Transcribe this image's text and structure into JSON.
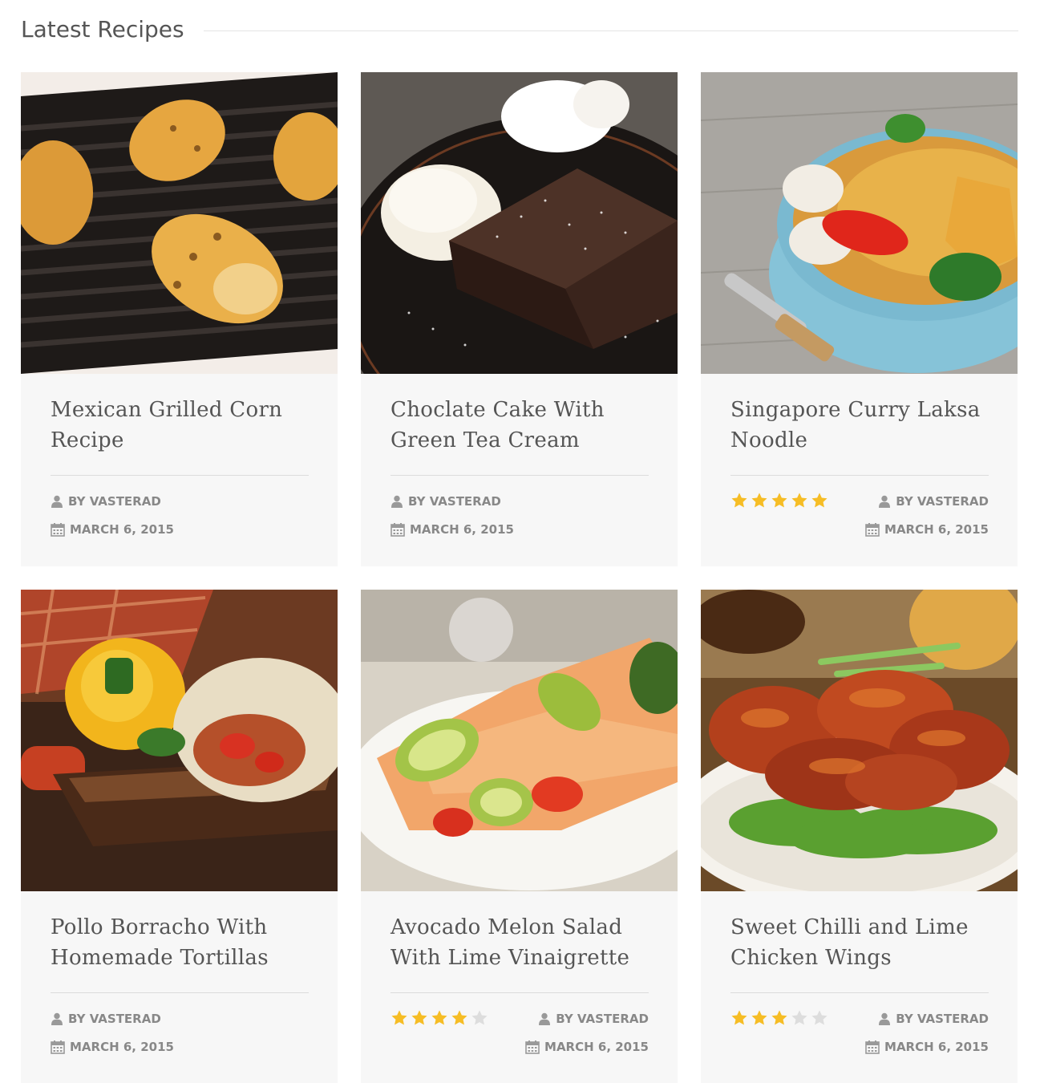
{
  "section": {
    "title": "Latest Recipes"
  },
  "colors": {
    "star_filled": "#f6bd25",
    "star_empty": "#dddddd",
    "card_background": "#f7f7f7",
    "meta_text": "#888888",
    "title_text": "#555555"
  },
  "recipes": [
    {
      "title": "Mexican Grilled Corn Recipe",
      "author": "BY VASTERAD",
      "date": "MARCH 6, 2015",
      "image": "grilled-corn-photo",
      "rating": null,
      "rating_max": 5
    },
    {
      "title": "Choclate Cake With Green Tea Cream",
      "author": "BY VASTERAD",
      "date": "MARCH 6, 2015",
      "image": "chocolate-cake-photo",
      "rating": null,
      "rating_max": 5
    },
    {
      "title": "Singapore Curry Laksa Noodle",
      "author": "BY VASTERAD",
      "date": "MARCH 6, 2015",
      "image": "laksa-noodle-photo",
      "rating": 5,
      "rating_max": 5
    },
    {
      "title": "Pollo Borracho With Homemade Tortillas",
      "author": "BY VASTERAD",
      "date": "MARCH 6, 2015",
      "image": "tortillas-photo",
      "rating": null,
      "rating_max": 5
    },
    {
      "title": "Avocado Melon Salad With Lime Vinaigrette",
      "author": "BY VASTERAD",
      "date": "MARCH 6, 2015",
      "image": "avocado-salad-photo",
      "rating": 4,
      "rating_max": 5
    },
    {
      "title": "Sweet Chilli and Lime Chicken Wings",
      "author": "BY VASTERAD",
      "date": "MARCH 6, 2015",
      "image": "chicken-wings-photo",
      "rating": 3,
      "rating_max": 5
    }
  ]
}
